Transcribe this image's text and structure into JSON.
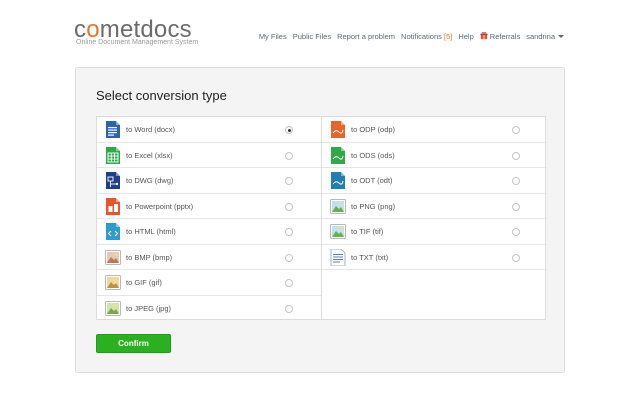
{
  "brand": {
    "name_pre": "c",
    "name_o": "o",
    "name_post": "metdocs",
    "tagline": "Online Document Management System"
  },
  "nav": {
    "my_files": "My Files",
    "public_files": "Public Files",
    "report": "Report a problem",
    "notifications": "Notifications",
    "notifications_badge": "[5]",
    "help": "Help",
    "referrals": "Referrals",
    "user": "sandrina"
  },
  "panel": {
    "title": "Select conversion type",
    "confirm_label": "Confirm",
    "selected": "to Word (docx)"
  },
  "options_left": [
    {
      "label": "to Word (docx)",
      "icon": "word-icon",
      "color": "#2a62b8",
      "checked": true
    },
    {
      "label": "to Excel (xlsx)",
      "icon": "excel-icon",
      "color": "#2fa84a",
      "checked": false
    },
    {
      "label": "to DWG (dwg)",
      "icon": "dwg-icon",
      "color": "#1f3f8a",
      "checked": false
    },
    {
      "label": "to Powerpoint (pptx)",
      "icon": "powerpoint-icon",
      "color": "#e8552a",
      "checked": false
    },
    {
      "label": "to HTML (html)",
      "icon": "html-icon",
      "color": "#2c9cd0",
      "checked": false
    },
    {
      "label": "to BMP (bmp)",
      "icon": "bmp-image-icon",
      "color": "#c98a6a",
      "checked": false
    },
    {
      "label": "to GIF (gif)",
      "icon": "gif-image-icon",
      "color": "#c9a24a",
      "checked": false
    },
    {
      "label": "to JPEG (jpg)",
      "icon": "jpeg-image-icon",
      "color": "#8bbf5a",
      "checked": false
    }
  ],
  "options_right": [
    {
      "label": "to ODP (odp)",
      "icon": "odp-icon",
      "color": "#e8642a",
      "checked": false
    },
    {
      "label": "to ODS (ods)",
      "icon": "ods-icon",
      "color": "#2fa84a",
      "checked": false
    },
    {
      "label": "to ODT (odt)",
      "icon": "odt-icon",
      "color": "#1e7fb0",
      "checked": false
    },
    {
      "label": "to PNG (png)",
      "icon": "png-image-icon",
      "color": "#6cb6d6",
      "checked": false
    },
    {
      "label": "to TIF (tif)",
      "icon": "tif-image-icon",
      "color": "#6cb6d6",
      "checked": false
    },
    {
      "label": "to TXT (txt)",
      "icon": "txt-icon",
      "color": "#5b7fb0",
      "checked": false
    }
  ]
}
